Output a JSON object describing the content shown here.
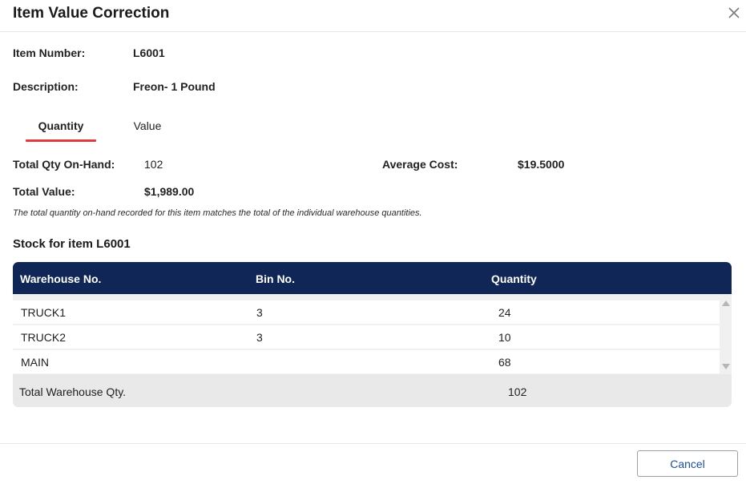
{
  "dialog": {
    "title": "Item Value Correction",
    "close_icon": "close-icon"
  },
  "item": {
    "number_label": "Item Number:",
    "number_value": "L6001",
    "description_label": "Description:",
    "description_value": "Freon- 1 Pound"
  },
  "tabs": [
    {
      "label": "Quantity",
      "active": true
    },
    {
      "label": "Value",
      "active": false
    }
  ],
  "summary": {
    "total_qty_label": "Total Qty On-Hand:",
    "total_qty_value": "102",
    "avg_cost_label": "Average Cost:",
    "avg_cost_value": "$19.5000",
    "total_value_label": "Total Value:",
    "total_value_value": "$1,989.00",
    "note": "The total quantity on-hand recorded for this item matches the total of the individual warehouse quantities."
  },
  "stock": {
    "title": "Stock for item L6001",
    "columns": [
      "Warehouse No.",
      "Bin No.",
      "Quantity"
    ],
    "rows": [
      {
        "warehouse": "TRUCK1",
        "bin": "3",
        "quantity": "24"
      },
      {
        "warehouse": "TRUCK2",
        "bin": "3",
        "quantity": "10"
      },
      {
        "warehouse": "MAIN",
        "bin": "",
        "quantity": "68"
      }
    ],
    "total_label": "Total Warehouse Qty.",
    "total_value": "102"
  },
  "footer": {
    "cancel_label": "Cancel"
  },
  "colors": {
    "header_bg": "#0f2657",
    "tab_accent": "#e03a3e",
    "cancel_text": "#1f4fa0"
  }
}
